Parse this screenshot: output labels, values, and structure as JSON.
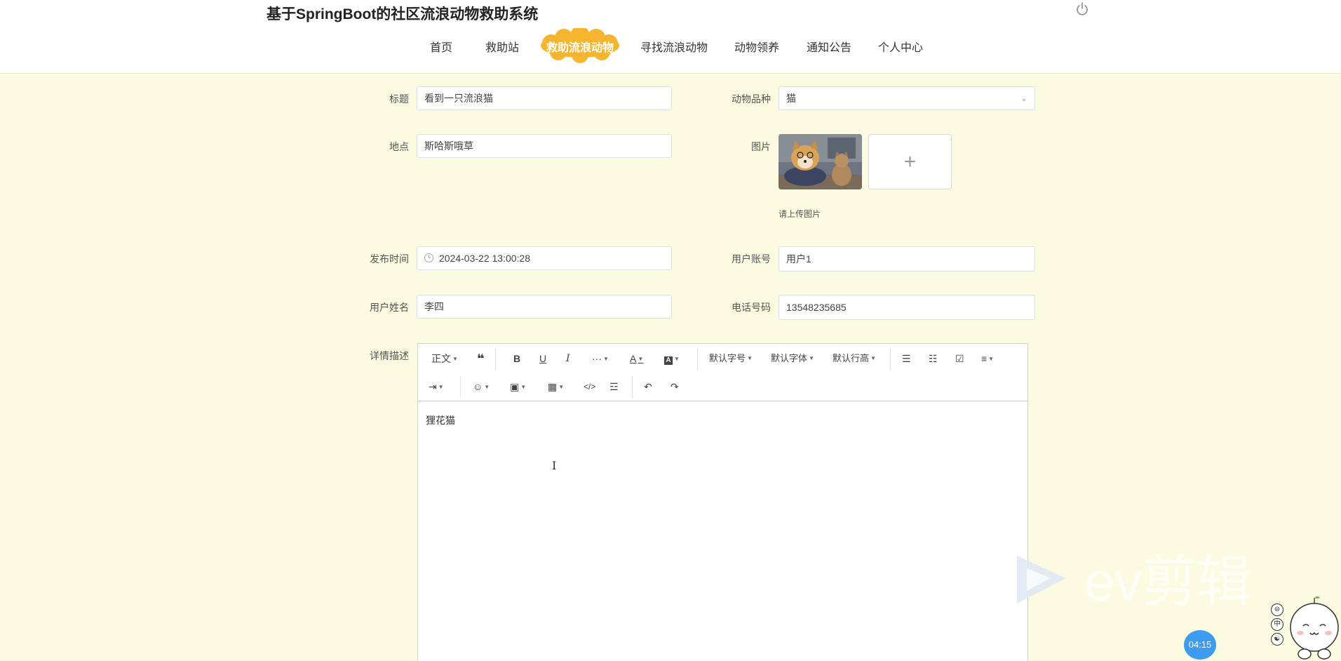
{
  "header": {
    "site_title": "基于SpringBoot的社区流浪动物救助系统",
    "nav": [
      "首页",
      "救助站",
      "救助流浪动物",
      "寻找流浪动物",
      "动物领养",
      "通知公告",
      "个人中心"
    ],
    "active_nav": "救助流浪动物"
  },
  "form": {
    "title_label": "标题",
    "title_value": "看到一只流浪猫",
    "breed_label": "动物品种",
    "breed_value": "猫",
    "location_label": "地点",
    "location_value": "斯哈斯哦草",
    "image_label": "图片",
    "upload_hint": "请上传图片",
    "publish_time_label": "发布时间",
    "publish_time_value": "2024-03-22 13:00:28",
    "account_label": "用户账号",
    "account_value": "用户1",
    "name_label": "用户姓名",
    "name_value": "李四",
    "phone_label": "电话号码",
    "phone_value": "13548235685",
    "detail_label": "详情描述"
  },
  "editor": {
    "paragraph_format": "正文",
    "font_size": "默认字号",
    "font_family": "默认字体",
    "line_height": "默认行高",
    "content": "狸花猫"
  },
  "overlay": {
    "watermark": "ev剪辑",
    "timer": "04:15",
    "side_icons": [
      "⊜",
      "中",
      "☯"
    ]
  }
}
